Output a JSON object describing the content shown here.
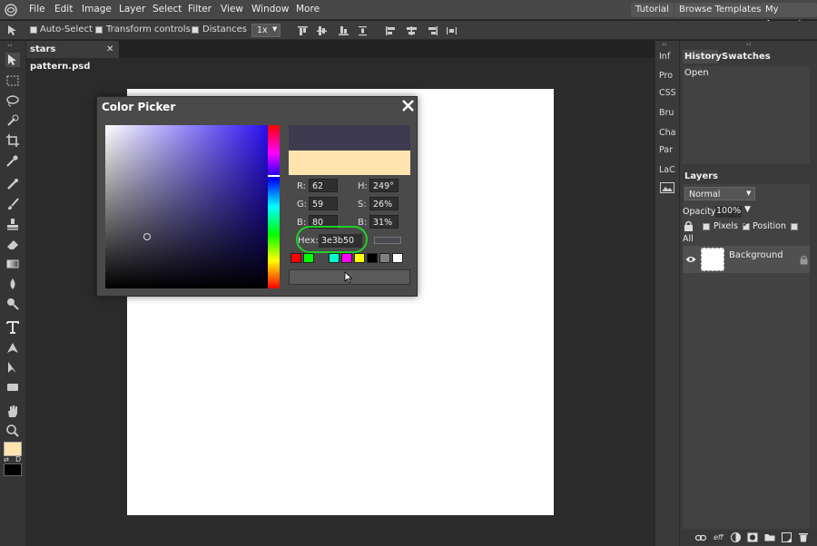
{
  "menubar": {
    "items": [
      "File",
      "Edit",
      "Image",
      "Layer",
      "Select",
      "Filter",
      "View",
      "Window",
      "More"
    ],
    "right_buttons": [
      "Tutorial",
      "Browse Templates",
      "My Account"
    ]
  },
  "optbar": {
    "auto_select": "Auto-Select",
    "transform_controls": "Transform controls",
    "distances": "Distances",
    "zoom_value": "1x"
  },
  "document": {
    "tab_title": "stars pattern.psd",
    "close": "✕"
  },
  "color_picker": {
    "title": "Color Picker",
    "labels": {
      "r": "R:",
      "g": "G:",
      "b": "B:",
      "h": "H:",
      "s": "S:",
      "bv": "B:",
      "hex": "Hex:"
    },
    "values": {
      "r": "62",
      "g": "59",
      "b": "80",
      "h": "249°",
      "s": "26%",
      "bv": "31%",
      "hex": "3e3b50"
    },
    "new_color": "#3e3b50",
    "old_color": "#ffe4b0",
    "presets": [
      "#ff0000",
      "#00ff00",
      "#00ffcc",
      "#ff00ff",
      "#ffff00",
      "#000000",
      "#808080",
      "#ffffff"
    ]
  },
  "mini_panel": {
    "items": [
      "Inf",
      "Pro",
      "CSS",
      "Bru",
      "Cha",
      "Par",
      "LaC"
    ]
  },
  "history": {
    "tabs": [
      "History",
      "Swatches"
    ],
    "entries": [
      "Open"
    ]
  },
  "layers": {
    "tab": "Layers",
    "blend_mode": "Normal",
    "opacity_label": "Opacity:",
    "opacity_value": "100%",
    "pixels": "Pixels",
    "position": "Position",
    "all": "All",
    "layer_name": "Background"
  }
}
